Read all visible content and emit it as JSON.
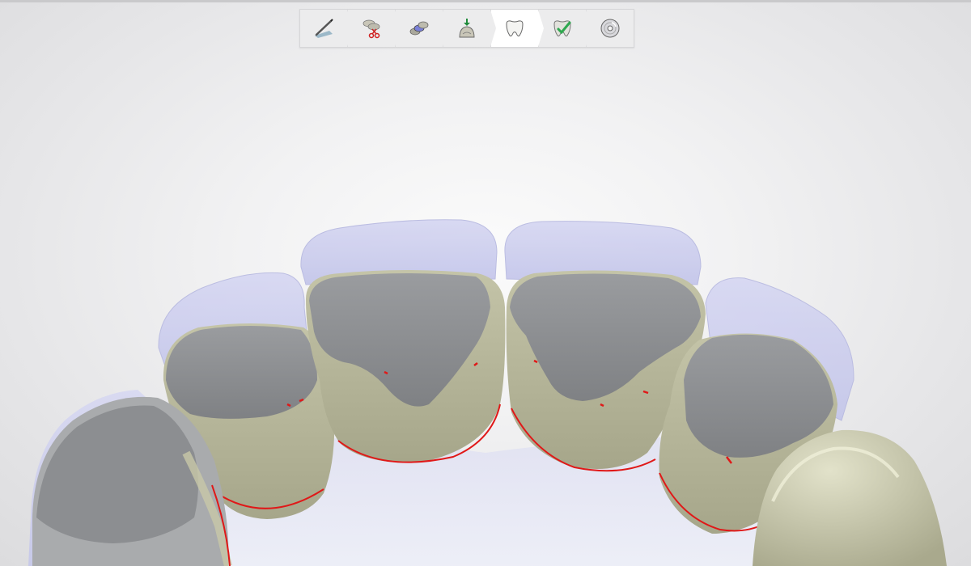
{
  "toolbar": {
    "steps": [
      {
        "icon": "margin-pen-icon",
        "state": "normal"
      },
      {
        "icon": "scissors-models-icon",
        "state": "normal"
      },
      {
        "icon": "insertion-axis-icon",
        "state": "normal"
      },
      {
        "icon": "die-spacer-icon",
        "state": "normal"
      },
      {
        "icon": "crown-icon",
        "state": "active"
      },
      {
        "icon": "crown-check-icon",
        "state": "normal"
      },
      {
        "icon": "save-disc-icon",
        "state": "normal"
      }
    ]
  },
  "colors": {
    "background": "#eeeeef",
    "wax_overlay": "#c7c8ec",
    "preparation_gray": "#8e9093",
    "stone_model": "#b8b89c",
    "margin_line": "#e01818",
    "check_green": "#2fa84f"
  }
}
